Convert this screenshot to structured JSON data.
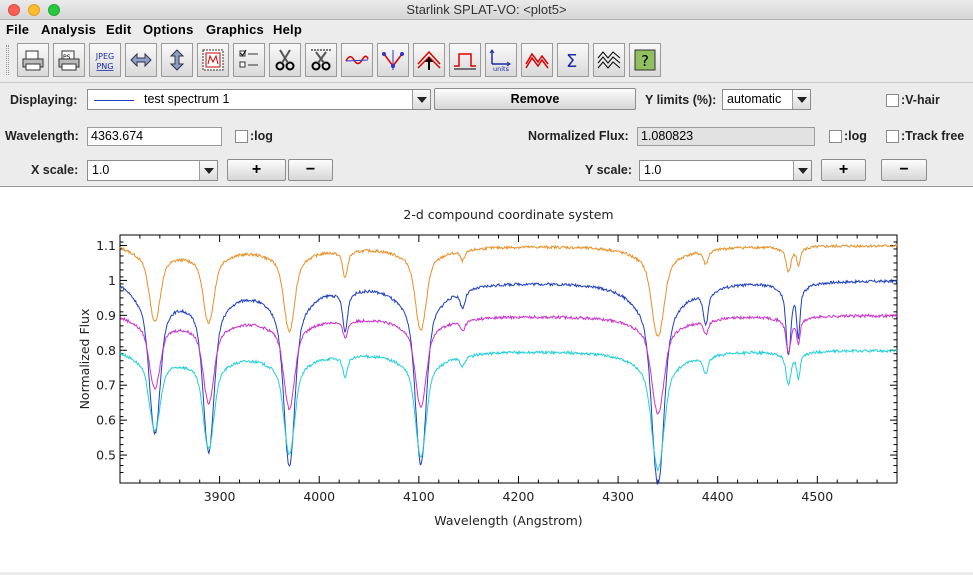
{
  "window": {
    "title": "Starlink SPLAT-VO: <plot5>"
  },
  "menus": [
    "File",
    "Analysis",
    "Edit",
    "Options",
    "Graphics",
    "Help"
  ],
  "toolbar": {
    "buttons": [
      {
        "name": "print-icon"
      },
      {
        "name": "print-postscript-icon"
      },
      {
        "name": "jpeg-png-icon",
        "text1": "JPEG",
        "text2": "PNG"
      },
      {
        "name": "horizontal-arrows-icon"
      },
      {
        "name": "vertical-arrows-icon"
      },
      {
        "name": "zoom-region-icon"
      },
      {
        "name": "checklist-icon"
      },
      {
        "name": "scissors-icon"
      },
      {
        "name": "region-cut-icon"
      },
      {
        "name": "sine-wave-icon"
      },
      {
        "name": "line-fit-icon"
      },
      {
        "name": "spectral-line-icon"
      },
      {
        "name": "filter-icon"
      },
      {
        "name": "units-icon",
        "text1": "units"
      },
      {
        "name": "peaks-icon"
      },
      {
        "name": "sigma-icon"
      },
      {
        "name": "stack-waves-icon"
      },
      {
        "name": "help-icon"
      }
    ]
  },
  "controls": {
    "displaying_label": "Displaying:",
    "displaying_value": "test spectrum 1",
    "remove_label": "Remove",
    "ylimits_label": "Y limits (%):",
    "ylimits_value": "automatic",
    "vhair_label": ":V-hair",
    "wavelength_label": "Wavelength:",
    "wavelength_value": "4363.674",
    "log_label": ":log",
    "nflux_label": "Normalized Flux:",
    "nflux_value": "1.080823",
    "log2_label": ":log",
    "trackfree_label": ":Track free",
    "xscale_label": "X scale:",
    "xscale_value": "1.0",
    "yscale_label": "Y scale:",
    "yscale_value": "1.0",
    "plus": "+",
    "minus": "−"
  },
  "chart_data": {
    "type": "line",
    "title": "2-d compound coordinate system",
    "xlabel": "Wavelength (Angstrom)",
    "ylabel": "Normalized Flux",
    "xlim": [
      3800,
      4580
    ],
    "ylim": [
      0.42,
      1.13
    ],
    "xticks": [
      3900,
      4000,
      4100,
      4200,
      4300,
      4400,
      4500
    ],
    "yticks": [
      0.5,
      0.6,
      0.7,
      0.8,
      0.9,
      1,
      1.1
    ],
    "ytick_labels": [
      "0.5",
      "0.6",
      "0.7",
      "0.8",
      "0.9",
      "1",
      "1.1"
    ],
    "lines": [
      {
        "center": 3835,
        "width": 7
      },
      {
        "center": 3889,
        "width": 7
      },
      {
        "center": 3970,
        "width": 7
      },
      {
        "center": 4026,
        "width": 3
      },
      {
        "center": 4102,
        "width": 7
      },
      {
        "center": 4144,
        "width": 3
      },
      {
        "center": 4340,
        "width": 8
      },
      {
        "center": 4388,
        "width": 3
      },
      {
        "center": 4471,
        "width": 3
      },
      {
        "center": 4481,
        "width": 2
      }
    ],
    "series": [
      {
        "color": "#e8912a",
        "continuum": 1.1,
        "depths": [
          0.21,
          0.21,
          0.24,
          0.08,
          0.24,
          0.03,
          0.26,
          0.04,
          0.07,
          0.05
        ],
        "start": 1.12
      },
      {
        "color": "#1f3fbf",
        "continuum": 1.0,
        "depths": [
          0.42,
          0.47,
          0.52,
          0.12,
          0.52,
          0.05,
          0.58,
          0.1,
          0.2,
          0.14
        ],
        "start": 1.04
      },
      {
        "color": "#cc33cc",
        "continuum": 0.9,
        "depths": [
          0.2,
          0.24,
          0.26,
          0.05,
          0.26,
          0.03,
          0.28,
          0.04,
          0.1,
          0.07
        ],
        "start": 0.92
      },
      {
        "color": "#22d0d8",
        "continuum": 0.8,
        "depths": [
          0.22,
          0.27,
          0.29,
          0.06,
          0.3,
          0.03,
          0.34,
          0.05,
          0.09,
          0.07
        ],
        "start": 0.82
      }
    ]
  }
}
